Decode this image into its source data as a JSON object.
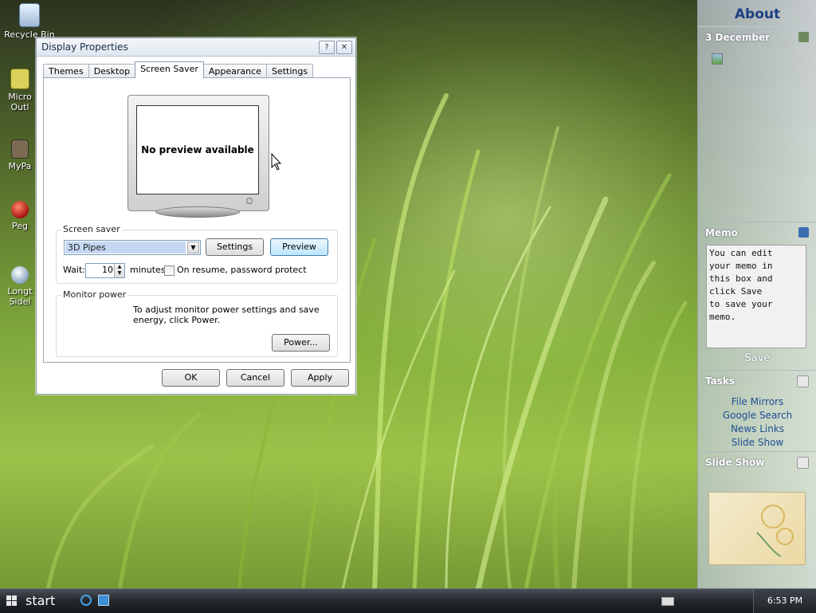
{
  "desktop": {
    "icons": [
      {
        "label": "Recycle Bin"
      },
      {
        "label": "Micro\nOutl"
      },
      {
        "label": "MyPa"
      },
      {
        "label": "Peg"
      },
      {
        "label": "Longt\nSidel"
      }
    ]
  },
  "dialog": {
    "title": "Display Properties",
    "help_btn": "?",
    "close_btn": "✕",
    "tabs": [
      "Themes",
      "Desktop",
      "Screen Saver",
      "Appearance",
      "Settings"
    ],
    "active_tab": "Screen Saver",
    "preview_text": "No preview available",
    "screensaver": {
      "label": "Screen saver",
      "selected": "3D Pipes",
      "settings_btn": "Settings",
      "preview_btn": "Preview",
      "wait_label": "Wait:",
      "wait_value": "10",
      "minutes_label": "minutes",
      "resume_label": "On resume, password protect",
      "resume_checked": false
    },
    "power": {
      "label": "Monitor power",
      "text": "To adjust monitor power settings and save energy, click Power.",
      "power_btn": "Power..."
    },
    "ok_btn": "OK",
    "cancel_btn": "Cancel",
    "apply_btn": "Apply"
  },
  "sidebar": {
    "header": "About",
    "calendar_title": "3 December",
    "memo_title": "Memo",
    "memo_text": "You can edit\nyour memo in\nthis box and\nclick Save\nto save your\nmemo.",
    "save_label": "Save",
    "tasks_title": "Tasks",
    "tasks": [
      "File Mirrors",
      "Google Search",
      "News Links",
      "Slide Show"
    ],
    "slideshow_title": "Slide Show"
  },
  "taskbar": {
    "start_label": "start",
    "clock": "6:53 PM"
  },
  "colors": {
    "sidebar_header": "#1d3f82",
    "task_link": "#1d4f96",
    "selection": "#c5d8f3"
  }
}
